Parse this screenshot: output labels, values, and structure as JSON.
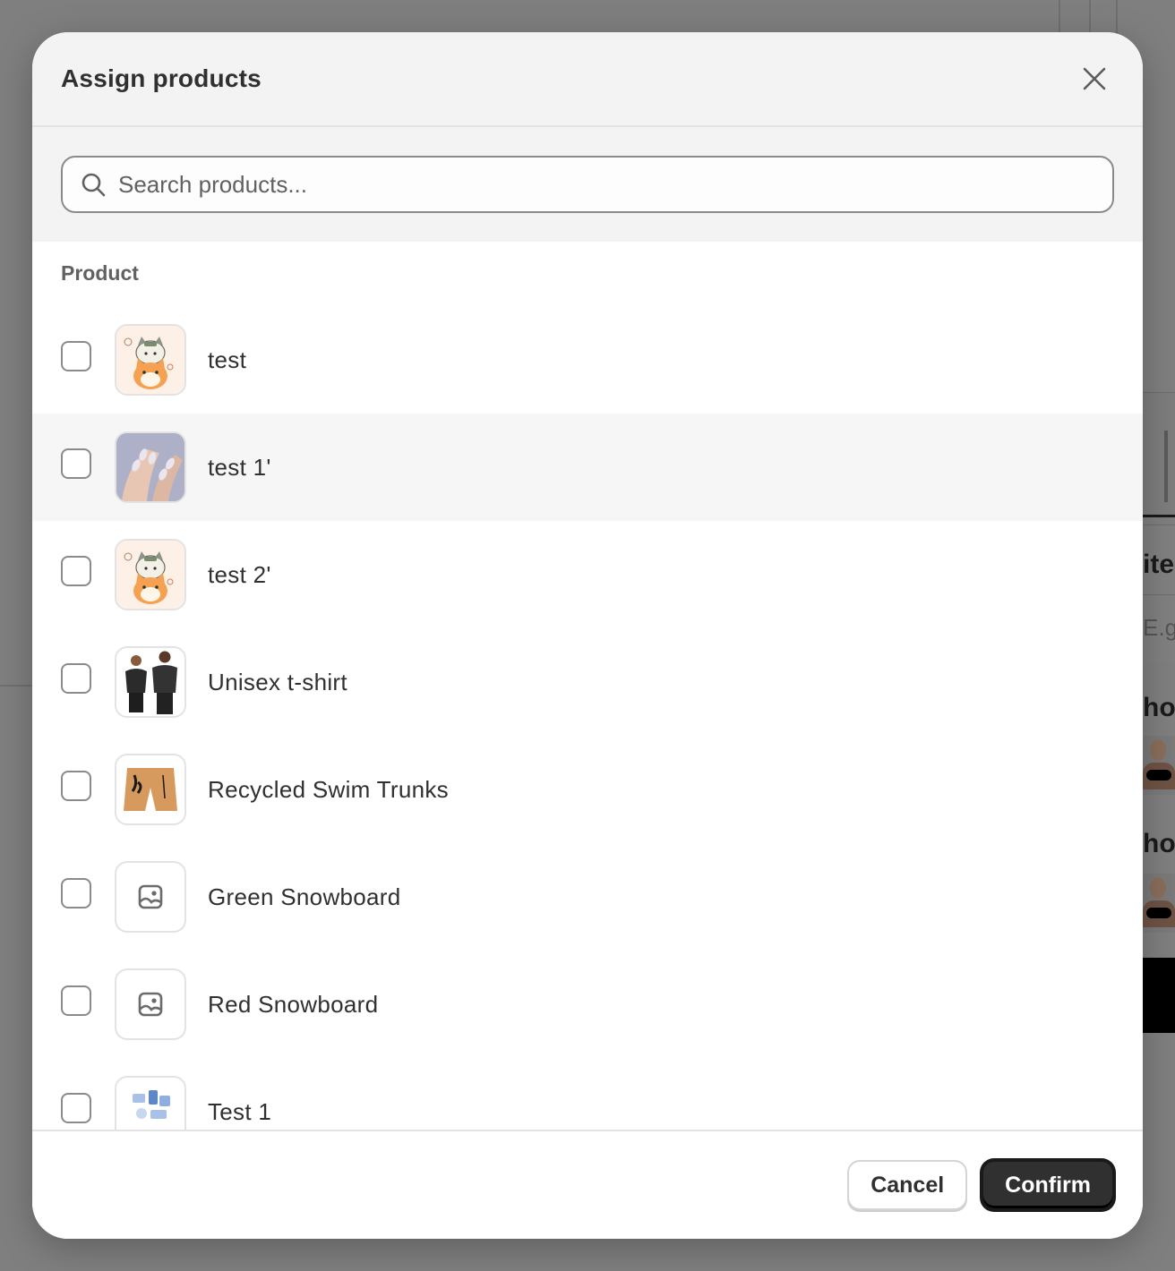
{
  "background": {
    "texts": [
      "iter",
      "E.g",
      "hoo",
      "hoo"
    ]
  },
  "modal": {
    "title": "Assign products",
    "close_icon": "close-icon",
    "search": {
      "placeholder": "Search products...",
      "value": "",
      "icon": "search-icon"
    },
    "column_header": "Product",
    "products": [
      {
        "label": "test",
        "image": "cartoon-cats"
      },
      {
        "label": "test 1'",
        "image": "nails"
      },
      {
        "label": "test 2'",
        "image": "cartoon-cats"
      },
      {
        "label": "Unisex t-shirt",
        "image": "tshirt-models"
      },
      {
        "label": "Recycled Swim Trunks",
        "image": "swim-trunks"
      },
      {
        "label": "Green Snowboard",
        "image": "placeholder-image-icon"
      },
      {
        "label": "Red Snowboard",
        "image": "placeholder-image-icon"
      },
      {
        "label": "Test 1",
        "image": "blue-illustration"
      }
    ],
    "footer": {
      "cancel_label": "Cancel",
      "confirm_label": "Confirm"
    }
  },
  "colors": {
    "overlay": "#808080",
    "header_bg": "#f3f3f3",
    "primary_button": "#303030",
    "hover_row": "#f6f6f6"
  }
}
